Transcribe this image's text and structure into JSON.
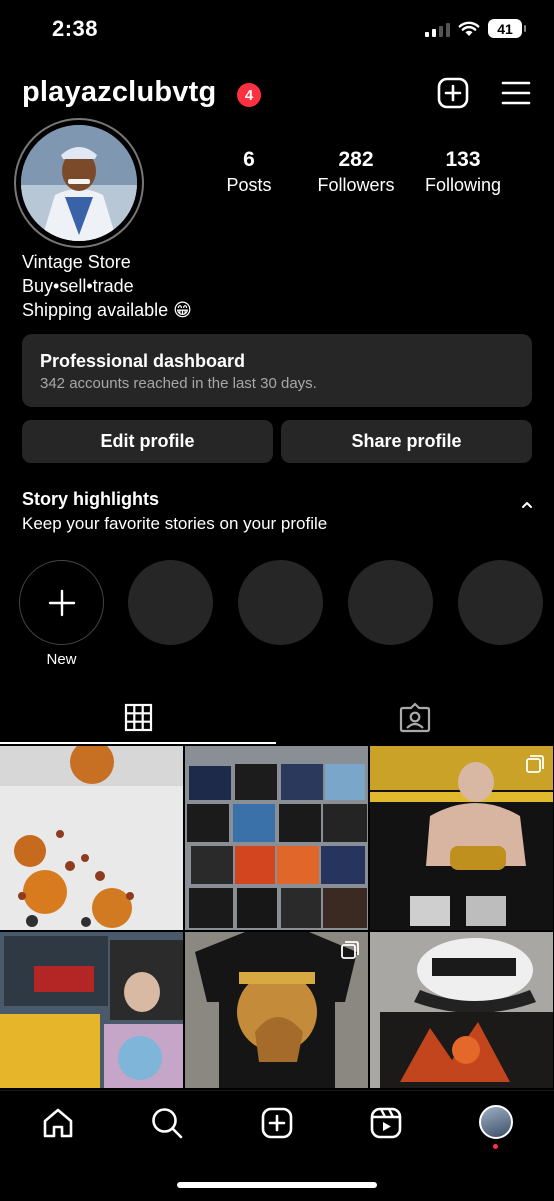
{
  "status_bar": {
    "time": "2:38",
    "battery": "41"
  },
  "header": {
    "username": "playazclubvtg",
    "notification_count": "4"
  },
  "stats": [
    {
      "number": "6",
      "label": "Posts"
    },
    {
      "number": "282",
      "label": "Followers"
    },
    {
      "number": "133",
      "label": "Following"
    }
  ],
  "bio": {
    "line1": "Vintage Store",
    "line2": "Buy•sell•trade",
    "line3": "Shipping available 😁"
  },
  "dashboard": {
    "title": "Professional dashboard",
    "subtitle": "342 accounts reached in the last 30 days."
  },
  "buttons": {
    "edit": "Edit profile",
    "share": "Share profile"
  },
  "highlights": {
    "title": "Story highlights",
    "subtitle": "Keep your favorite stories on your profile",
    "new_label": "New"
  },
  "colors": {
    "badge": "#ff3040",
    "surface": "#262626",
    "background": "#000000"
  },
  "icons": [
    "plus-square-icon",
    "menu-icon",
    "grid-icon",
    "tagged-icon",
    "home-icon",
    "search-icon",
    "create-icon",
    "reels-icon"
  ]
}
